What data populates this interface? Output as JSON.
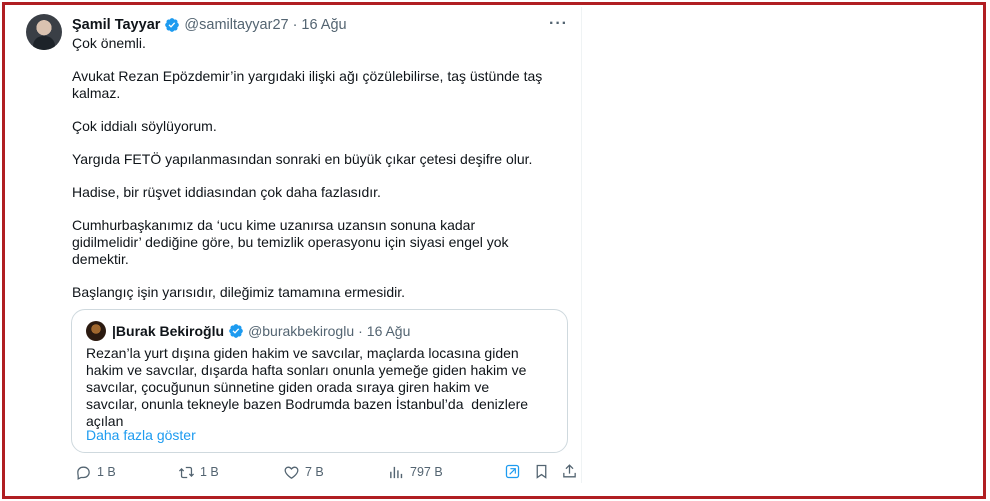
{
  "tweet": {
    "author_name": "Şamil Tayyar",
    "author_handle": "@samiltayyar27",
    "separator": "·",
    "date": "16 Ağu",
    "more_label": "···",
    "paragraphs": [
      "Çok önemli.",
      "Avukat Rezan Epözdemir’in yargıdaki ilişki ağı çözülebilirse, taş üstünde taş\nkalmaz.",
      "Çok iddialı söylüyorum.",
      "Yargıda FETÖ yapılanmasından sonraki en büyük çıkar çetesi deşifre olur.",
      "Hadise, bir rüşvet iddiasından çok daha fazlasıdır.",
      "Cumhurbaşkanımız da ‘ucu kime uzanırsa uzansın sonuna kadar\ngidilmelidir’ dediğine göre, bu temizlik operasyonu için siyasi engel yok\ndemektir.",
      "Başlangıç işin yarısıdır, dileğimiz tamamına ermesidir."
    ]
  },
  "quote": {
    "author_name": "|Burak Bekiroğlu",
    "author_handle": "@burakbekiroglu",
    "separator": "·",
    "date": "16 Ağu",
    "text": "Rezan’la yurt dışına giden hakim ve savcılar, maçlarda locasına giden\nhakim ve savcılar, dışarda hafta sonları onunla yemeğe giden hakim ve\nsavcılar, çocuğunun sünnetine giden orada sıraya giren hakim ve\nsavcılar, onunla tekneyle bazen Bodrumda bazen İstanbul’da  denizlere\naçılan",
    "show_more": "Daha fazla göster"
  },
  "actions": {
    "replies": "1 B",
    "retweets": "1 B",
    "likes": "7 B",
    "views": "797 B"
  },
  "colors": {
    "frame_border": "#b01e22",
    "accent": "#1d9bf0",
    "secondary_text": "#536471"
  },
  "icons": [
    "verified-badge-icon",
    "more-icon",
    "reply-icon",
    "retweet-icon",
    "like-icon",
    "views-icon",
    "grok-icon",
    "bookmark-icon",
    "share-icon"
  ]
}
